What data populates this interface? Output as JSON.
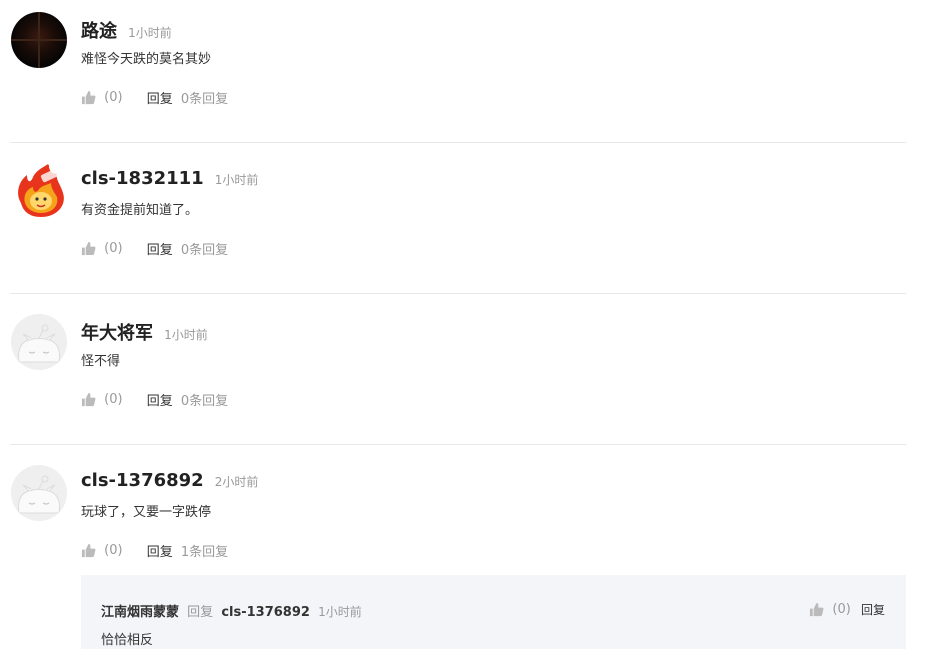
{
  "comments": [
    {
      "user": "路途",
      "time": "1小时前",
      "content": "难怪今天跌的莫名其妙",
      "likes": "(0)",
      "reply_label": "回复",
      "reply_count": "0条回复",
      "avatar": "dark-grid-avatar"
    },
    {
      "user": "cls-1832111",
      "time": "1小时前",
      "content": "有资金提前知道了。",
      "likes": "(0)",
      "reply_label": "回复",
      "reply_count": "0条回复",
      "avatar": "fire-mascot-avatar"
    },
    {
      "user": "年大将军",
      "time": "1小时前",
      "content": "怪不得",
      "likes": "(0)",
      "reply_label": "回复",
      "reply_count": "0条回复",
      "avatar": "default-avatar"
    },
    {
      "user": "cls-1376892",
      "time": "2小时前",
      "content": "玩球了，又要一字跌停",
      "likes": "(0)",
      "reply_label": "回复",
      "reply_count": "1条回复",
      "avatar": "default-avatar"
    }
  ],
  "nested_reply": {
    "user": "江南烟雨蒙蒙",
    "reply_word": "回复",
    "target": "cls-1376892",
    "time": "1小时前",
    "content": "恰恰相反",
    "likes": "(0)",
    "reply_label": "回复"
  },
  "colors": {
    "muted": "#999999",
    "text": "#333333",
    "divider": "#e8e8e8",
    "nested_bg": "#f4f5f9",
    "mascot_red": "#e8341c"
  }
}
